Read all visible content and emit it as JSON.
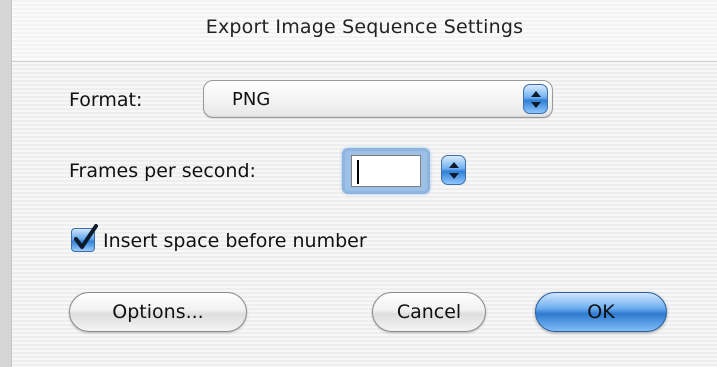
{
  "dialog": {
    "title": "Export Image Sequence Settings"
  },
  "format": {
    "label": "Format:",
    "selected_value": "PNG",
    "arrows_icon": "up-down-arrows-icon"
  },
  "fps": {
    "label": "Frames per second:",
    "value": "",
    "arrows_icon": "up-down-arrows-icon"
  },
  "insert_space": {
    "label": "Insert space before number",
    "checked": true
  },
  "buttons": {
    "options": "Options...",
    "cancel": "Cancel",
    "ok": "OK"
  },
  "colors": {
    "aqua_accent": "#2f7fd4",
    "focus_ring": "#9cc0e6"
  }
}
